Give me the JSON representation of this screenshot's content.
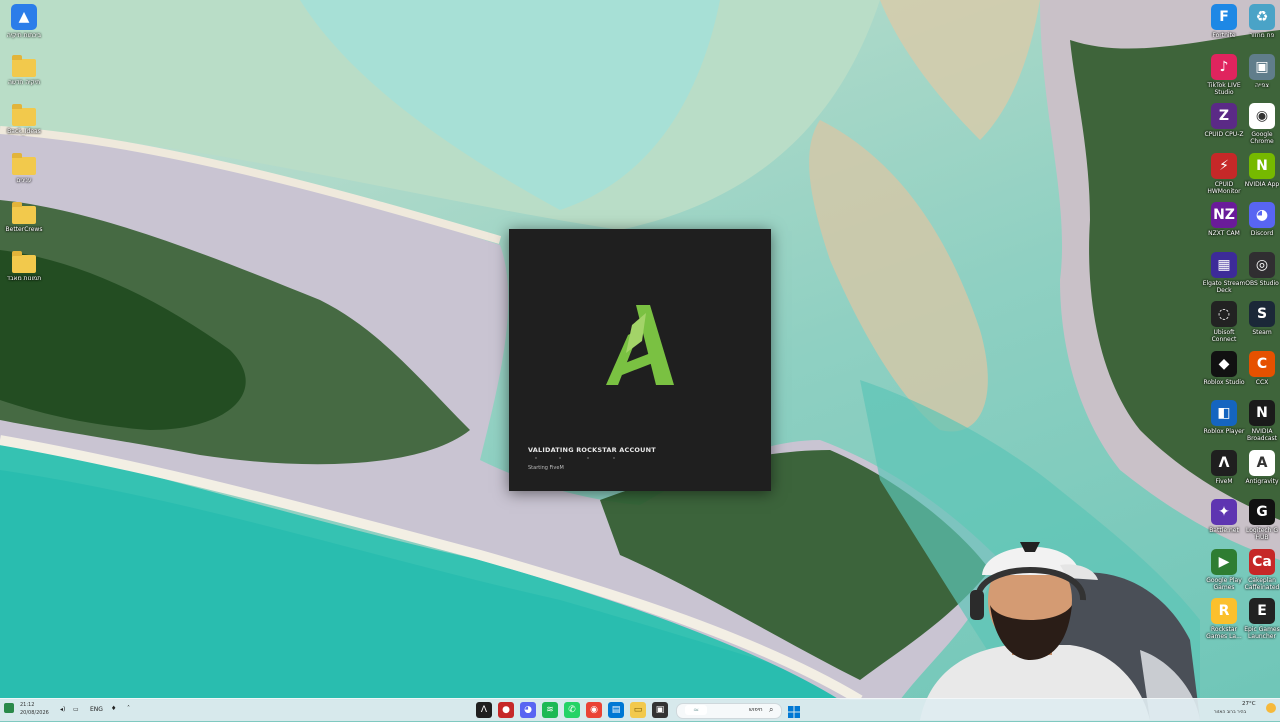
{
  "desktop": {
    "left_icons": [
      {
        "label": "ביכתות תיקיה",
        "kind": "app",
        "color": "#2b7de9"
      },
      {
        "label": "תיקיה חדשה",
        "kind": "folder"
      },
      {
        "label": "Back_Ideas",
        "kind": "folder"
      },
      {
        "label": "ענינים",
        "kind": "folder"
      },
      {
        "label": "BetterCrews",
        "kind": "folder"
      },
      {
        "label": "תמונות מאבד",
        "kind": "folder"
      }
    ],
    "right_icons": [
      {
        "label": "Fortnite",
        "color": "#1e88e5",
        "glyph": "F"
      },
      {
        "label": "פח מחזור",
        "color": "#4aa3c7",
        "glyph": "♻"
      },
      {
        "label": "TikTok LIVE Studio",
        "color": "#e0245e",
        "glyph": "♪"
      },
      {
        "label": "צפייה",
        "color": "#607d8b",
        "glyph": "▣"
      },
      {
        "label": "CPUID CPU-Z",
        "color": "#5b2a86",
        "glyph": "Z"
      },
      {
        "label": "Google Chrome",
        "color": "#ffffff",
        "glyph": "◉"
      },
      {
        "label": "CPUID HWMonitor",
        "color": "#c62828",
        "glyph": "⚡"
      },
      {
        "label": "NVIDIA App",
        "color": "#76b900",
        "glyph": "N"
      },
      {
        "label": "NZXT CAM",
        "color": "#6a1b9a",
        "glyph": "NZ"
      },
      {
        "label": "Discord",
        "color": "#5865f2",
        "glyph": "◕"
      },
      {
        "label": "Elgato Stream Deck",
        "color": "#3d2b99",
        "glyph": "▦"
      },
      {
        "label": "OBS Studio",
        "color": "#302e31",
        "glyph": "◎"
      },
      {
        "label": "Ubisoft Connect",
        "color": "#222222",
        "glyph": "◌"
      },
      {
        "label": "Steam",
        "color": "#1b2838",
        "glyph": "S"
      },
      {
        "label": "Roblox Studio",
        "color": "#111111",
        "glyph": "◆"
      },
      {
        "label": "CCX",
        "color": "#e65100",
        "glyph": "C"
      },
      {
        "label": "Roblox Player",
        "color": "#1565c0",
        "glyph": "◧"
      },
      {
        "label": "NVIDIA Broadcast",
        "color": "#1a1a1a",
        "glyph": "N"
      },
      {
        "label": "FiveM",
        "color": "#1f1f1f",
        "glyph": "Λ"
      },
      {
        "label": "Antigravity",
        "color": "#ffffff",
        "glyph": "A"
      },
      {
        "label": "Battle.net",
        "color": "#5e35b1",
        "glyph": "✦"
      },
      {
        "label": "Logitech G HUB",
        "color": "#111111",
        "glyph": "G"
      },
      {
        "label": "Google Play Games",
        "color": "#2e7d32",
        "glyph": "▶"
      },
      {
        "label": "Cakeplan Caffeinated",
        "color": "#c62828",
        "glyph": "Ca"
      },
      {
        "label": "Rockstar Games La...",
        "color": "#fbc02d",
        "glyph": "R"
      },
      {
        "label": "Epic Games Launcher",
        "color": "#222222",
        "glyph": "E"
      }
    ]
  },
  "fivem_window": {
    "status_title": "VALIDATING ROCKSTAR ACCOUNT",
    "status_sub": "Starting FiveM"
  },
  "taskbar": {
    "time": "21:12",
    "date": "20/08/2026",
    "language": "ENG",
    "weather": "27°C",
    "weather_sub": "בהיר ברוב האזור",
    "search_label": "חיפוש",
    "colors": {
      "accent": "#0078d4"
    },
    "pinned": [
      {
        "name": "fivem",
        "color": "#1f1f1f",
        "glyph": "Λ"
      },
      {
        "name": "rockstar",
        "color": "#c62828",
        "glyph": "●"
      },
      {
        "name": "discord",
        "color": "#5865f2",
        "glyph": "◕"
      },
      {
        "name": "spotify",
        "color": "#1db954",
        "glyph": "≋"
      },
      {
        "name": "whatsapp",
        "color": "#25d366",
        "glyph": "✆"
      },
      {
        "name": "chrome",
        "color": "#ea4335",
        "glyph": "◉"
      },
      {
        "name": "store",
        "color": "#0078d4",
        "glyph": "▤"
      },
      {
        "name": "file-explorer",
        "color": "#f2c94c",
        "glyph": "▭"
      },
      {
        "name": "app",
        "color": "#333333",
        "glyph": "▣"
      }
    ]
  }
}
